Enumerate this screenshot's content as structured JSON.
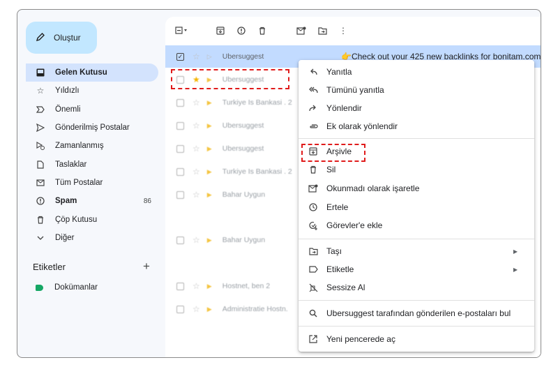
{
  "sidebar": {
    "compose_label": "Oluştur",
    "items": [
      {
        "label": "Gelen Kutusu",
        "icon": "inbox-icon"
      },
      {
        "label": "Yıldızlı",
        "icon": "star-icon"
      },
      {
        "label": "Önemli",
        "icon": "important-icon"
      },
      {
        "label": "Gönderilmiş Postalar",
        "icon": "send-icon"
      },
      {
        "label": "Zamanlanmış",
        "icon": "scheduled-icon"
      },
      {
        "label": "Taslaklar",
        "icon": "draft-icon"
      },
      {
        "label": "Tüm Postalar",
        "icon": "all-mail-icon"
      },
      {
        "label": "Spam",
        "icon": "spam-icon",
        "count": "86"
      },
      {
        "label": "Çöp Kutusu",
        "icon": "trash-icon"
      },
      {
        "label": "Diğer",
        "icon": "chevron-down-icon"
      }
    ],
    "labels_title": "Etiketler",
    "labels": [
      {
        "label": "Dokümanlar",
        "color": "#16a765"
      }
    ]
  },
  "emails": [
    {
      "sender": "Ubersuggest",
      "snippet": "👉Check out your 425 new backlinks for bonitam.com",
      "selected": true,
      "starred": false,
      "important": false
    },
    {
      "sender": "Ubersuggest",
      "snippet": "",
      "selected": false,
      "starred": true,
      "important": true
    },
    {
      "sender": "Turkiye Is Bankasi . 2",
      "snippet": "",
      "selected": false,
      "starred": false,
      "important": true
    },
    {
      "sender": "Ubersuggest",
      "snippet": "",
      "selected": false,
      "starred": false,
      "important": true
    },
    {
      "sender": "Ubersuggest",
      "snippet": "",
      "selected": false,
      "starred": false,
      "important": true
    },
    {
      "sender": "Turkiye Is Bankasi . 2",
      "snippet": "",
      "selected": false,
      "starred": false,
      "important": true
    },
    {
      "sender": "Bahar Uygun",
      "snippet": "",
      "selected": false,
      "starred": false,
      "important": true
    },
    {
      "sender": "Bahar Uygun",
      "snippet": "",
      "selected": false,
      "starred": false,
      "important": true
    },
    {
      "sender": "Hostnet, ben 2",
      "snippet": "",
      "selected": false,
      "starred": false,
      "important": true
    },
    {
      "sender": "Administratie Hostn.",
      "snippet": "",
      "selected": false,
      "starred": false,
      "important": true
    }
  ],
  "context_menu": {
    "items": [
      {
        "label": "Yanıtla",
        "icon": "reply-icon"
      },
      {
        "label": "Tümünü yanıtla",
        "icon": "reply-all-icon"
      },
      {
        "label": "Yönlendir",
        "icon": "forward-icon"
      },
      {
        "label": "Ek olarak yönlendir",
        "icon": "attachment-icon"
      },
      {
        "label": "Arşivle",
        "icon": "archive-icon"
      },
      {
        "label": "Sil",
        "icon": "trash-icon"
      },
      {
        "label": "Okunmadı olarak işaretle",
        "icon": "mark-unread-icon"
      },
      {
        "label": "Ertele",
        "icon": "snooze-icon"
      },
      {
        "label": "Görevler'e ekle",
        "icon": "add-task-icon"
      },
      {
        "label": "Taşı",
        "icon": "move-to-icon"
      },
      {
        "label": "Etiketle",
        "icon": "label-icon"
      },
      {
        "label": "Sessize Al",
        "icon": "mute-icon"
      },
      {
        "label": "Ubersuggest tarafından gönderilen e-postaları bul",
        "icon": "search-icon"
      },
      {
        "label": "Yeni pencerede aç",
        "icon": "open-in-new-icon"
      }
    ]
  }
}
